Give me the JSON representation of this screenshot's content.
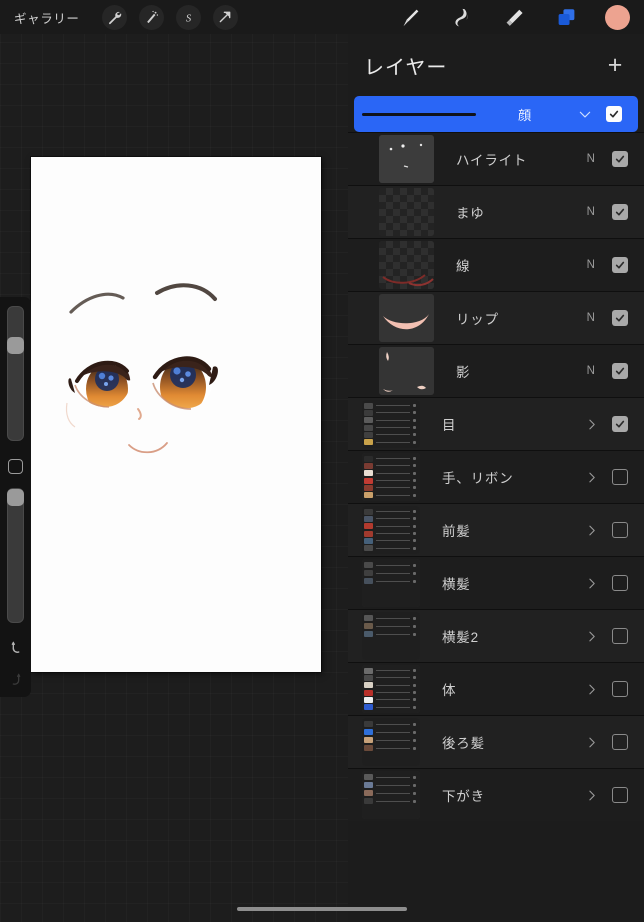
{
  "app": {
    "name": "Procreate",
    "background_color": "#1d1d1d",
    "accent_color": "#2a66f6"
  },
  "toolbar": {
    "gallery_label": "ギャラリー",
    "left_tools": [
      {
        "name": "wrench-icon",
        "label": "アクション"
      },
      {
        "name": "adjustments-icon",
        "label": "調整"
      },
      {
        "name": "selection-icon",
        "label": "選択"
      },
      {
        "name": "transform-icon",
        "label": "変形"
      }
    ],
    "right_tools": [
      {
        "name": "brush-icon",
        "label": "ブラシ",
        "active": false
      },
      {
        "name": "smudge-icon",
        "label": "スマッジ",
        "active": false
      },
      {
        "name": "eraser-icon",
        "label": "消しゴム",
        "active": false
      },
      {
        "name": "layers-icon",
        "label": "レイヤー",
        "active": true
      },
      {
        "name": "color-swatch",
        "label": "カラー",
        "color": "#eda390"
      }
    ]
  },
  "sidebar": {
    "brush_size_slider": {
      "label": "ブラシサイズ",
      "value": 78
    },
    "modify_button": {
      "label": "修正"
    },
    "opacity_slider": {
      "label": "不透明度",
      "value": 100
    },
    "undo_button": {
      "label": "取り消す",
      "enabled": true
    },
    "redo_button": {
      "label": "やり直す",
      "enabled": false
    }
  },
  "canvas": {
    "artwork_title": "顔イラスト",
    "background": "#fdfdfd"
  },
  "layers_panel": {
    "title": "レイヤー",
    "add_label": "+",
    "layers": [
      {
        "name": "顔",
        "type": "group",
        "indent": false,
        "selected": true,
        "visible": true,
        "blend": "",
        "expanded": true,
        "thumb": "bar"
      },
      {
        "name": "ハイライト",
        "type": "layer",
        "indent": true,
        "selected": false,
        "visible": true,
        "blend": "N",
        "thumb": "highlight"
      },
      {
        "name": "まゆ",
        "type": "layer",
        "indent": true,
        "selected": false,
        "visible": true,
        "blend": "N",
        "thumb": "checker"
      },
      {
        "name": "線",
        "type": "layer",
        "indent": true,
        "selected": false,
        "visible": true,
        "blend": "N",
        "thumb": "checker-line"
      },
      {
        "name": "リップ",
        "type": "layer",
        "indent": true,
        "selected": false,
        "visible": true,
        "blend": "N",
        "thumb": "lip"
      },
      {
        "name": "影",
        "type": "layer",
        "indent": true,
        "selected": false,
        "visible": true,
        "blend": "N",
        "thumb": "shadow"
      },
      {
        "name": "目",
        "type": "group",
        "indent": true,
        "selected": false,
        "visible": true,
        "blend": "",
        "thumb": "stack-eye"
      },
      {
        "name": "手、リボン",
        "type": "group",
        "indent": false,
        "selected": false,
        "visible": false,
        "blend": "",
        "thumb": "stack-hand"
      },
      {
        "name": "前髪",
        "type": "group",
        "indent": false,
        "selected": false,
        "visible": false,
        "blend": "",
        "thumb": "stack-bangs"
      },
      {
        "name": "横髪",
        "type": "group",
        "indent": false,
        "selected": false,
        "visible": false,
        "blend": "",
        "thumb": "stack-side"
      },
      {
        "name": "横髪2",
        "type": "group",
        "indent": false,
        "selected": false,
        "visible": false,
        "blend": "",
        "thumb": "stack-side2"
      },
      {
        "name": "体",
        "type": "group",
        "indent": false,
        "selected": false,
        "visible": false,
        "blend": "",
        "thumb": "stack-body"
      },
      {
        "name": "後ろ髪",
        "type": "group",
        "indent": false,
        "selected": false,
        "visible": false,
        "blend": "",
        "thumb": "stack-back"
      },
      {
        "name": "下がき",
        "type": "group",
        "indent": false,
        "selected": false,
        "visible": false,
        "blend": "",
        "thumb": "stack-sketch"
      }
    ]
  }
}
